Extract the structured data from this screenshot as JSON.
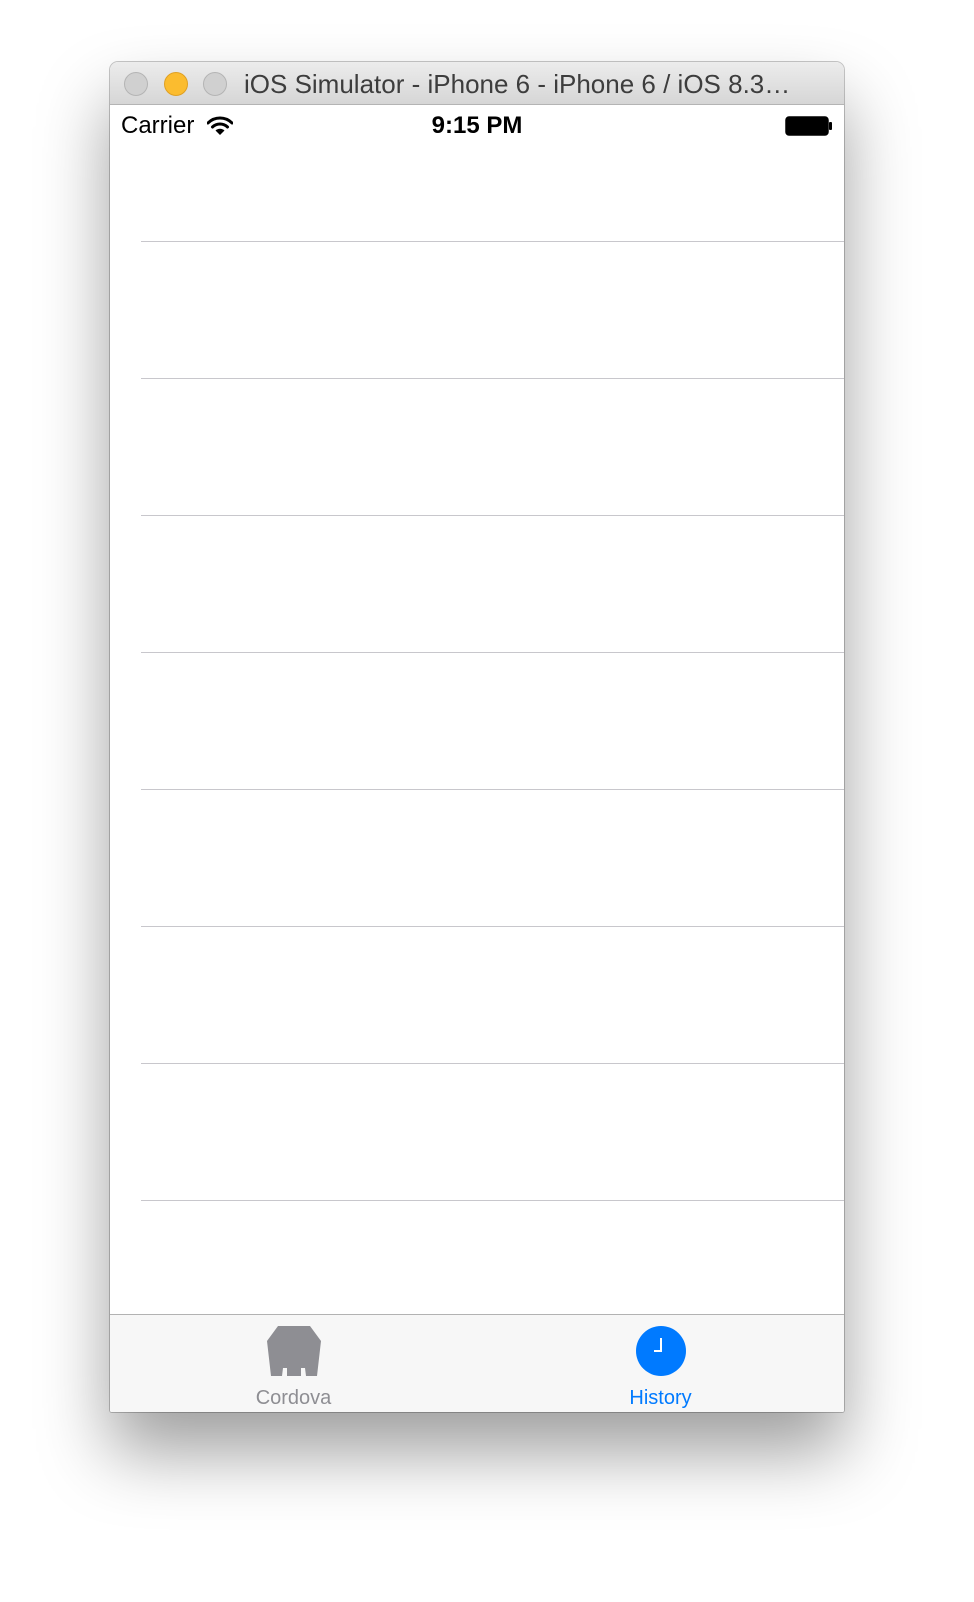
{
  "window": {
    "title": "iOS Simulator - iPhone 6 - iPhone 6 / iOS 8.3…"
  },
  "statusbar": {
    "carrier": "Carrier",
    "time": "9:15 PM"
  },
  "table": {
    "row_count": 8
  },
  "tabbar": {
    "tabs": [
      {
        "label": "Cordova",
        "icon": "cordova-icon",
        "selected": false,
        "color": "#8e8e93"
      },
      {
        "label": "History",
        "icon": "clock-icon",
        "selected": true,
        "color": "#007aff"
      }
    ]
  },
  "colors": {
    "accent": "#007aff",
    "inactive": "#8e8e93",
    "separator": "#c8c7cc"
  }
}
